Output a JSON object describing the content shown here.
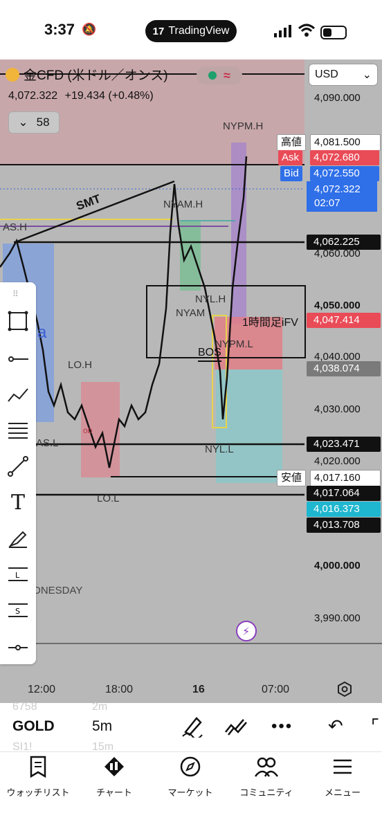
{
  "status_bar": {
    "time": "3:37",
    "app_pill": "TradingView"
  },
  "symbol": {
    "title": "金CFD (米ドル／オンス)",
    "price": "4,072.322",
    "change": "+19.434 (+0.48%)",
    "indicator_toggle_count": "58"
  },
  "currency_select": "USD",
  "price_axis": {
    "labels": [
      "4,090.000",
      "4,060.000",
      "4,050.000",
      "4,040.000",
      "4,030.000",
      "4,020.000",
      "4,000.000",
      "3,990.000"
    ],
    "high": {
      "label": "高値",
      "value": "4,081.500"
    },
    "ask": {
      "label": "Ask",
      "value": "4,072.680"
    },
    "bid": {
      "label": "Bid",
      "value": "4,072.550"
    },
    "last": {
      "value": "4,072.322",
      "countdown": "02:07"
    },
    "level_tags": [
      "4,062.225",
      "4,047.414",
      "4,038.074",
      "4,023.471",
      "4,017.064",
      "4,016.373",
      "4,013.708"
    ],
    "low": {
      "label": "安値",
      "value": "4,017.160"
    }
  },
  "annotations": {
    "smt": "SMT",
    "nypm_h": "NYPM.H",
    "nyam_h": "NYAM.H",
    "as_h": "AS.H",
    "nyl_h": "NYL.H",
    "nyam": "NYAM",
    "ifv": "1時間足iFV",
    "nypm_l": "NYPM.L",
    "bos": "BOS",
    "lo_h": "LO.H",
    "as_l": "AS.L",
    "nyl_l": "NYL.L",
    "lo_l": "LO.L",
    "a": "a",
    "ob": "ob",
    "weekday": "DNESDAY"
  },
  "time_axis": [
    "12:00",
    "18:00",
    "16",
    "07:00"
  ],
  "bottom_toolbar": {
    "symbol": "GOLD",
    "interval": "5m",
    "ghost_above_symbol": "6758",
    "ghost_below_symbol": "SI1!",
    "ghost_above_interval": "2m",
    "ghost_below_interval": "15m"
  },
  "drawing_tools": [
    "rectangle-tool-icon",
    "horizontal-ray-icon",
    "trend-tools-icon",
    "fib-tools-icon",
    "line-tool-icon",
    "text-tool-icon",
    "brush-tool-icon",
    "long-position-icon",
    "short-position-icon",
    "horizontal-line-icon"
  ],
  "nav": [
    {
      "label": "ウォッチリスト",
      "icon": "watchlist-icon"
    },
    {
      "label": "チャート",
      "icon": "chart-icon"
    },
    {
      "label": "マーケット",
      "icon": "compass-icon"
    },
    {
      "label": "コミュニティ",
      "icon": "community-icon"
    },
    {
      "label": "メニュー",
      "icon": "menu-icon"
    }
  ],
  "colors": {
    "chart_bg": "#b8b8b8",
    "ask_red": "#e94b57",
    "bid_blue": "#2f6fe8",
    "cyan": "#1fb6cf",
    "purple_box": "#a887c9",
    "blue_box": "#7b9de0",
    "red_zone": "#d98a93",
    "teal_zone": "#8cc7c9",
    "green_zone": "#6fbf8f"
  }
}
